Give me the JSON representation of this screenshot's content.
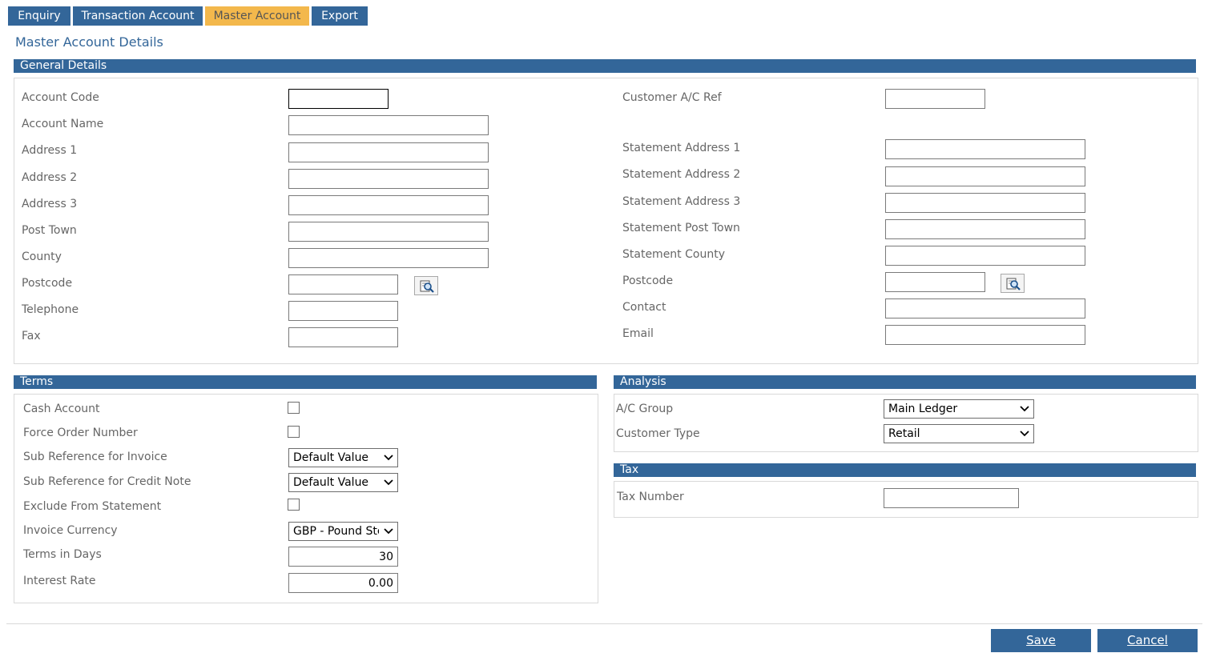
{
  "tabs": [
    {
      "label": "Enquiry"
    },
    {
      "label": "Transaction Account"
    },
    {
      "label": "Master Account"
    },
    {
      "label": "Export"
    }
  ],
  "page_title": "Master Account Details",
  "general": {
    "header": "General Details",
    "account_code": "Account Code",
    "account_name": "Account Name",
    "address1": "Address 1",
    "address2": "Address 2",
    "address3": "Address 3",
    "post_town": "Post Town",
    "county": "County",
    "postcode": "Postcode",
    "telephone": "Telephone",
    "fax": "Fax",
    "customer_ac_ref": "Customer A/C Ref",
    "stmt_address1": "Statement Address 1",
    "stmt_address2": "Statement Address 2",
    "stmt_address3": "Statement Address 3",
    "stmt_post_town": "Statement Post Town",
    "stmt_county": "Statement County",
    "stmt_postcode": "Postcode",
    "contact": "Contact",
    "email": "Email"
  },
  "terms": {
    "header": "Terms",
    "cash_account": "Cash Account",
    "force_order_number": "Force Order Number",
    "sub_ref_invoice": "Sub Reference for Invoice",
    "sub_ref_invoice_value": "Default Value",
    "sub_ref_credit": "Sub Reference for Credit Note",
    "sub_ref_credit_value": "Default Value",
    "exclude_statement": "Exclude From Statement",
    "invoice_currency": "Invoice Currency",
    "invoice_currency_value": "GBP - Pound Sterling",
    "terms_days": "Terms in Days",
    "terms_days_value": "30",
    "interest_rate": "Interest Rate",
    "interest_rate_value": "0.00"
  },
  "analysis": {
    "header": "Analysis",
    "ac_group": "A/C Group",
    "ac_group_value": "Main Ledger",
    "customer_type": "Customer Type",
    "customer_type_value": "Retail"
  },
  "tax": {
    "header": "Tax",
    "tax_number": "Tax Number"
  },
  "buttons": {
    "save": "Save",
    "cancel": "Cancel"
  }
}
